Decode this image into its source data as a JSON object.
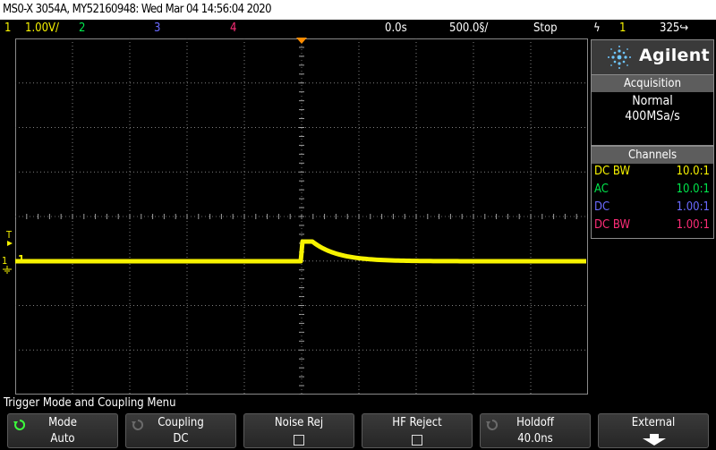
{
  "title": "MS0-X 3054A, MY52160948: Wed Mar 04 14:56:04 2020",
  "status": {
    "ch1_num": "1",
    "ch1_scale": "1.00V/",
    "ch2_num": "2",
    "ch3_num": "3",
    "ch4_num": "4",
    "delay": "0.0s",
    "timebase": "500.0§/",
    "run_state": "Stop",
    "trigger_icon": "ϟ",
    "trigger_source": "1",
    "trigger_level": "325↪"
  },
  "brand": "Agilent",
  "acquisition": {
    "header": "Acquisition",
    "mode": "Normal",
    "rate": "400MSa/s"
  },
  "channels": {
    "header": "Channels",
    "rows": [
      {
        "coupling": "DC BW",
        "probe": "10.0:1",
        "color": "#f7f300"
      },
      {
        "coupling": "AC",
        "probe": "10.0:1",
        "color": "#00e64c"
      },
      {
        "coupling": "DC",
        "probe": "1.00:1",
        "color": "#6a6aff"
      },
      {
        "coupling": "DC BW",
        "probe": "1.00:1",
        "color": "#ff2d78"
      }
    ]
  },
  "markers": {
    "trigger_T": "T",
    "ground_1": "1",
    "trace_1": "1"
  },
  "menu": {
    "title": "Trigger Mode and Coupling Menu",
    "softkeys": [
      {
        "label": "Mode",
        "value": "Auto"
      },
      {
        "label": "Coupling",
        "value": "DC"
      },
      {
        "label": "Noise Rej",
        "value": ""
      },
      {
        "label": "HF Reject",
        "value": ""
      },
      {
        "label": "Holdoff",
        "value": "40.0ns"
      },
      {
        "label": "External",
        "value": ""
      }
    ]
  },
  "colors": {
    "ch1": "#f7f300",
    "ch2": "#00e64c",
    "ch3": "#6a6aff",
    "ch4": "#ff2d78",
    "grid": "#7f7f7f",
    "trigger_marker": "#ff8c00"
  }
}
